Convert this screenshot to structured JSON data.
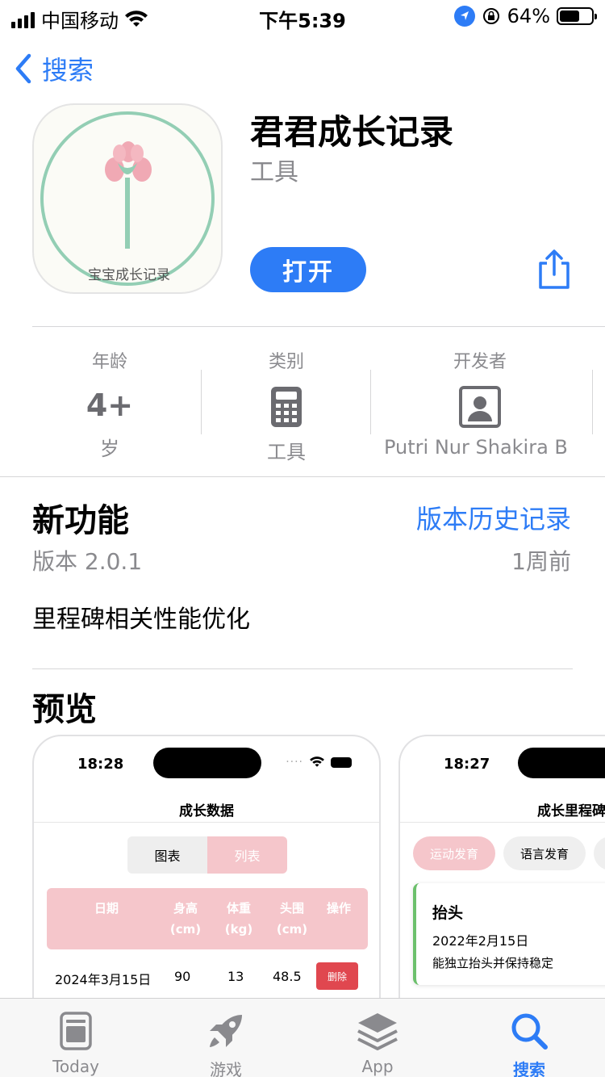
{
  "status_bar": {
    "carrier": "中国移动",
    "time": "下午5:39",
    "battery": "64%",
    "battery_level": 0.64
  },
  "nav": {
    "back_label": "搜索"
  },
  "app": {
    "icon_text": "宝宝成长记录",
    "title": "君君成长记录",
    "subtitle": "工具",
    "open_label": "打开"
  },
  "info": {
    "age_label": "年龄",
    "age_value": "4+",
    "age_unit": "岁",
    "category_label": "类别",
    "category_value": "工具",
    "developer_label": "开发者",
    "developer_value": "Putri Nur Shakira B"
  },
  "whats_new": {
    "title": "新功能",
    "history_link": "版本历史记录",
    "version": "版本 2.0.1",
    "date": "1周前",
    "notes": "里程碑相关性能优化"
  },
  "preview": {
    "title": "预览",
    "card1": {
      "time": "18:28",
      "title": "成长数据",
      "seg_chart": "图表",
      "seg_list": "列表",
      "headers": [
        "日期",
        "身高\n(cm)",
        "体重\n(kg)",
        "头围\n(cm)",
        "操作"
      ],
      "row": {
        "date": "2024年3月15日",
        "height": "90",
        "weight": "13",
        "head": "48.5",
        "action": "删除"
      }
    },
    "card2": {
      "time": "18:27",
      "title": "成长里程碑",
      "chip1": "运动发育",
      "chip2": "语言发育",
      "milestone_title": "抬头",
      "milestone_date": "2022年2月15日",
      "milestone_desc": "能独立抬头并保持稳定"
    }
  },
  "tabbar": {
    "tabs": [
      {
        "label": "Today",
        "icon": "today-icon"
      },
      {
        "label": "游戏",
        "icon": "rocket-icon"
      },
      {
        "label": "App",
        "icon": "app-stack-icon"
      },
      {
        "label": "搜索",
        "icon": "search-icon"
      }
    ]
  },
  "colors": {
    "accent": "#2d7cf6",
    "pink": "#f5c6cb",
    "delete": "#e0474f",
    "green": "#6cc06c"
  }
}
